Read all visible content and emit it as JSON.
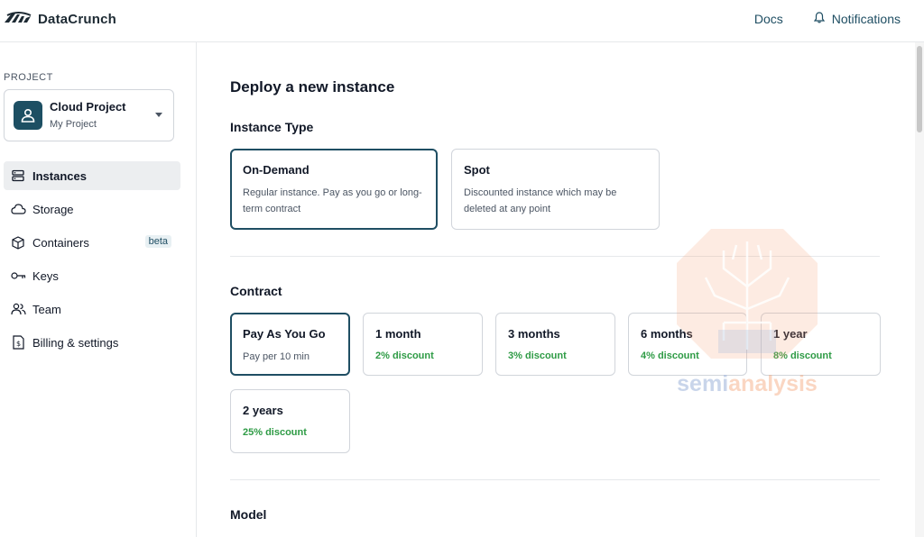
{
  "header": {
    "brand": "DataCrunch",
    "docs_link": "Docs",
    "notifications_link": "Notifications"
  },
  "sidebar": {
    "section_label": "PROJECT",
    "project": {
      "name": "Cloud Project",
      "subtitle": "My Project"
    },
    "items": [
      {
        "label": "Instances",
        "icon": "server-icon",
        "active": true
      },
      {
        "label": "Storage",
        "icon": "cloud-icon"
      },
      {
        "label": "Containers",
        "icon": "cube-icon",
        "badge": "beta"
      },
      {
        "label": "Keys",
        "icon": "key-icon"
      },
      {
        "label": "Team",
        "icon": "team-icon"
      },
      {
        "label": "Billing & settings",
        "icon": "billing-icon"
      }
    ]
  },
  "main": {
    "title": "Deploy a new instance",
    "instance_type": {
      "heading": "Instance Type",
      "options": [
        {
          "title": "On-Demand",
          "description": "Regular instance. Pay as you go or long-term contract",
          "selected": true
        },
        {
          "title": "Spot",
          "description": "Discounted instance which may be deleted at any point",
          "selected": false
        }
      ]
    },
    "contract": {
      "heading": "Contract",
      "options": [
        {
          "title": "Pay As You Go",
          "subtitle": "Pay per 10 min",
          "selected": true
        },
        {
          "title": "1 month",
          "discount": "2% discount"
        },
        {
          "title": "3 months",
          "discount": "3% discount"
        },
        {
          "title": "6 months",
          "discount": "4% discount"
        },
        {
          "title": "1 year",
          "discount": "8% discount"
        },
        {
          "title": "2 years",
          "discount": "25% discount"
        }
      ]
    },
    "model": {
      "heading": "Model"
    }
  },
  "watermark": {
    "text": "semianalysis"
  },
  "colors": {
    "accent": "#1f4e63",
    "discount": "#2e9b45",
    "watermark": "#f4a57a"
  }
}
